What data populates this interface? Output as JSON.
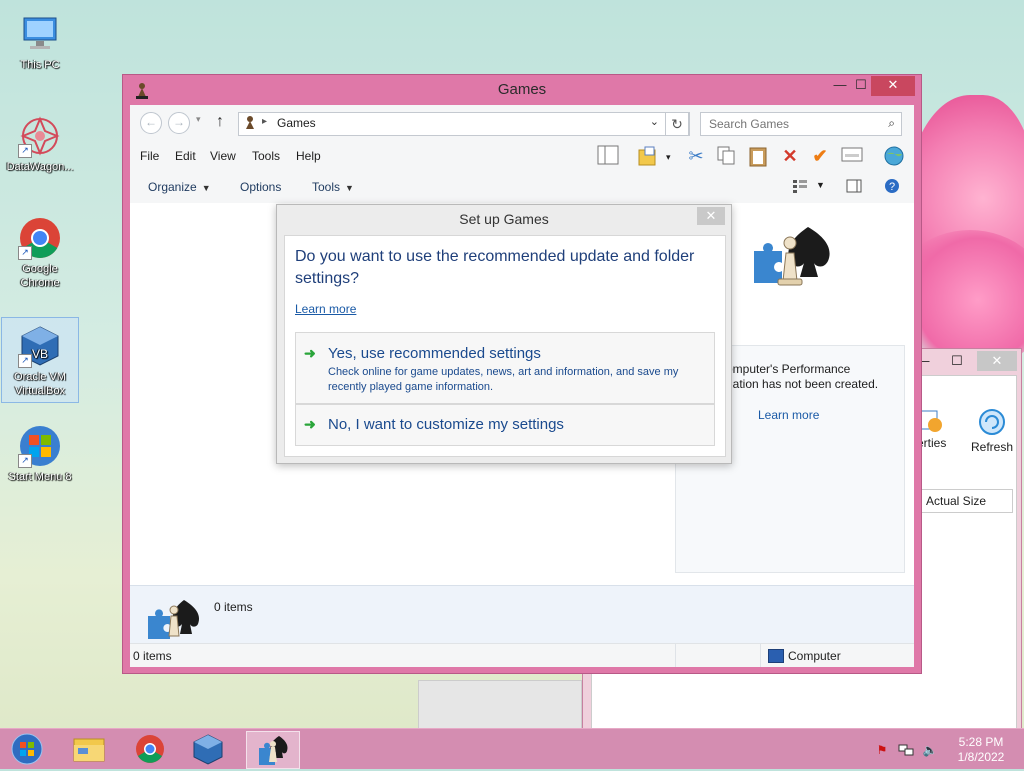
{
  "desktop": {
    "icons": [
      {
        "label": "This PC"
      },
      {
        "label": "DataWagon..."
      },
      {
        "label": "Google Chrome"
      },
      {
        "label": "Oracle VM VirtualBox"
      },
      {
        "label": "Start Menu 8"
      }
    ]
  },
  "background_window": {
    "min": "—",
    "max": "☐",
    "close": "✕",
    "properties_label": "erties",
    "refresh_label": "Refresh",
    "column_header": "Actual Size"
  },
  "window": {
    "title": "Games",
    "controls": {
      "min": "—",
      "max": "☐",
      "close": "✕"
    },
    "address": {
      "location": "Games",
      "search_placeholder": "Search Games"
    },
    "menu": [
      "File",
      "Edit",
      "View",
      "Tools",
      "Help"
    ],
    "commands": {
      "organize": "Organize",
      "options": "Options",
      "tools": "Tools"
    },
    "side_panel": {
      "line1": "omputer's Performance",
      "line2": "nation has not been created.",
      "learn_more": "Learn more"
    },
    "details": {
      "count": "0 items"
    },
    "status": {
      "left": "0 items",
      "right": "Computer"
    }
  },
  "dialog": {
    "title": "Set up Games",
    "close": "✕",
    "question": "Do you want to use the recommended update and folder settings?",
    "learn_more": "Learn more",
    "option1": {
      "title": "Yes, use recommended settings",
      "desc": "Check online for game updates, news, art and information, and save my recently played game information."
    },
    "option2": {
      "title": "No, I want to customize my settings"
    }
  },
  "taskbar": {
    "time": "5:28 PM",
    "date": "1/8/2022"
  }
}
